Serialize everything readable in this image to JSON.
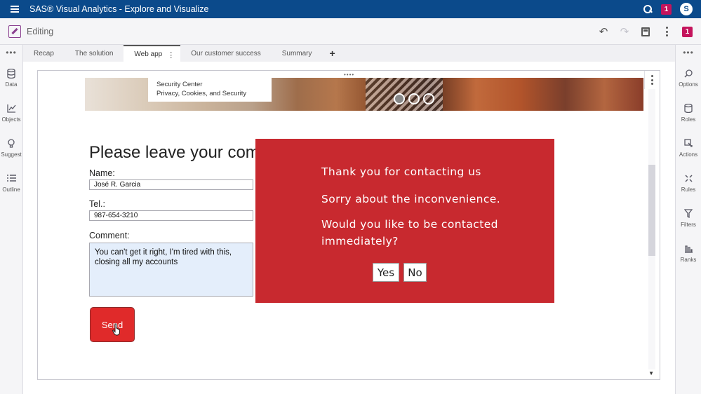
{
  "app": {
    "title": "SAS® Visual Analytics - Explore and Visualize",
    "notification_count": "1",
    "user_initial": "S"
  },
  "editbar": {
    "mode_label": "Editing",
    "report_badge": "1"
  },
  "left_sidebar": {
    "items": [
      {
        "label": "Data",
        "icon": "database-icon"
      },
      {
        "label": "Objects",
        "icon": "chart-icon"
      },
      {
        "label": "Suggest",
        "icon": "lightbulb-icon"
      },
      {
        "label": "Outline",
        "icon": "list-icon"
      }
    ]
  },
  "right_sidebar": {
    "items": [
      {
        "label": "Options",
        "icon": "options-icon"
      },
      {
        "label": "Roles",
        "icon": "roles-icon"
      },
      {
        "label": "Actions",
        "icon": "actions-icon"
      },
      {
        "label": "Rules",
        "icon": "rules-icon"
      },
      {
        "label": "Filters",
        "icon": "filter-icon"
      },
      {
        "label": "Ranks",
        "icon": "ranks-icon"
      }
    ]
  },
  "tabs": [
    {
      "label": "Recap"
    },
    {
      "label": "The solution"
    },
    {
      "label": "Web app",
      "active": true
    },
    {
      "label": "Our customer success"
    },
    {
      "label": "Summary"
    }
  ],
  "hero": {
    "link1": "Security Center",
    "link2": "Privacy, Cookies, and Security"
  },
  "form": {
    "title": "Please leave your comm",
    "name_label": "Name:",
    "name_value": "José R. Garcia",
    "tel_label": "Tel.:",
    "tel_value": "987-654-3210",
    "comment_label": "Comment:",
    "comment_value": "You can't get it right, I'm tired with this, closing all my accounts",
    "send_label": "Send"
  },
  "popup": {
    "line1": "Thank you for contacting us",
    "line2": "Sorry about the  inconvenience.",
    "line3": "Would you like to be contacted",
    "line4": "immediately?",
    "yes_label": "Yes",
    "no_label": "No",
    "background_color": "#c8292f"
  },
  "colors": {
    "app_bar": "#0b4a8b",
    "badge": "#c4145c",
    "send_button": "#e02a2a",
    "comment_bg": "#e4eefb"
  }
}
